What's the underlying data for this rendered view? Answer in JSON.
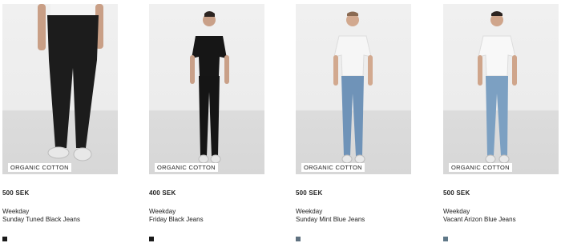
{
  "products": [
    {
      "badge": "ORGANIC COTTON",
      "price": "500 SEK",
      "brand": "Weekday",
      "name": "Sunday Tuned Black Jeans",
      "swatch_color": "#1a1a1a",
      "jeans_color": "#1c1c1c",
      "top_color": "#f4f4f4"
    },
    {
      "badge": "ORGANIC COTTON",
      "price": "400 SEK",
      "brand": "Weekday",
      "name": "Friday Black Jeans",
      "swatch_color": "#1a1a1a",
      "jeans_color": "#151515",
      "top_color": "#161616"
    },
    {
      "badge": "ORGANIC COTTON",
      "price": "500 SEK",
      "brand": "Weekday",
      "name": "Sunday Mint Blue Jeans",
      "swatch_color": "#5f7180",
      "jeans_color": "#6f93b8",
      "top_color": "#f6f6f6"
    },
    {
      "badge": "ORGANIC COTTON",
      "price": "500 SEK",
      "brand": "Weekday",
      "name": "Vacant Arizon Blue Jeans",
      "swatch_color": "#5f7888",
      "jeans_color": "#7ca0c2",
      "top_color": "#f8f8f8"
    }
  ]
}
